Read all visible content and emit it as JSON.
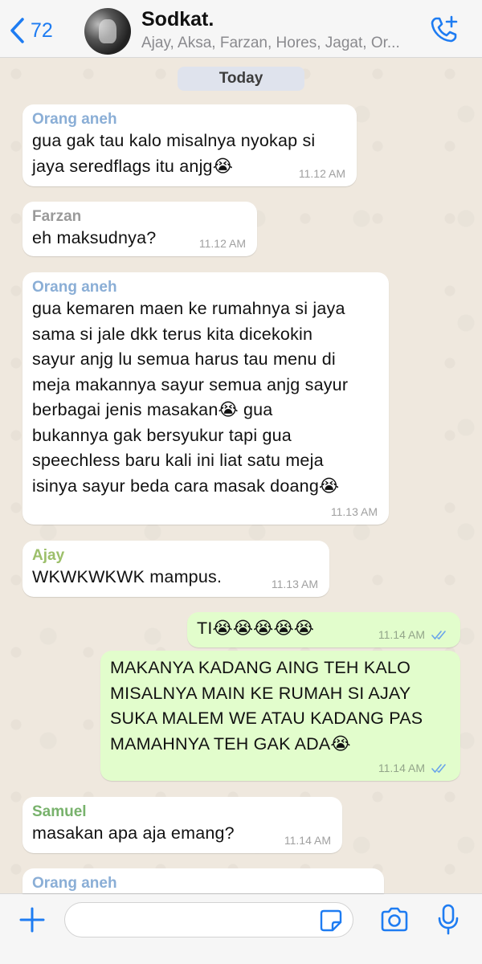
{
  "header": {
    "back_count": "72",
    "title": "Sodkat.",
    "members": "Ajay, Aksa, Farzan, Hores, Jagat, Or..."
  },
  "date_divider": "Today",
  "messages": [
    {
      "sender": "Orang aneh",
      "sender_color": "#8aaed6",
      "text": "gua gak tau kalo misalnya nyokap si\njaya seredflags itu anjg😭",
      "time": "11.12 AM",
      "outgoing": false
    },
    {
      "sender": "Farzan",
      "sender_color": "#9a9a9a",
      "text": "eh maksudnya?",
      "time": "11.12 AM",
      "outgoing": false
    },
    {
      "sender": "Orang aneh",
      "sender_color": "#8aaed6",
      "text": "gua kemaren maen ke rumahnya si jaya\nsama si jale dkk terus kita dicekokin\nsayur anjg lu semua harus tau menu di\nmeja makannya sayur semua anjg sayur\nberbagai jenis masakan😭 gua\nbukannya gak bersyukur tapi gua\nspeechless baru kali ini liat satu meja\nisinya sayur beda cara masak doang😭",
      "time": "11.13 AM",
      "outgoing": false
    },
    {
      "sender": "Ajay",
      "sender_color": "#9cbf6a",
      "text": "WKWKWKWK mampus.",
      "time": "11.13 AM",
      "outgoing": false
    },
    {
      "sender": "",
      "text": "TI😭😭😭😭😭",
      "time": "11.14 AM",
      "outgoing": true
    },
    {
      "sender": "",
      "text": "MAKANYA KADANG AING TEH KALO\nMISALNYA MAIN KE RUMAH SI AJAY\nSUKA MALEM WE ATAU KADANG PAS\nMAMAHNYA TEH GAK ADA😭",
      "time": "11.14 AM",
      "outgoing": true
    },
    {
      "sender": "Samuel",
      "sender_color": "#78b26c",
      "text": "masakan apa aja emang?",
      "time": "11.14 AM",
      "outgoing": false
    },
    {
      "sender": "Orang aneh",
      "sender_color": "#8aaed6",
      "text": "",
      "time": "",
      "outgoing": false
    }
  ],
  "composer": {
    "placeholder": ""
  },
  "colors": {
    "accent": "#1e7cf2",
    "outgoing_bubble": "#e2fdcc",
    "incoming_bubble": "#ffffff"
  },
  "icons": [
    "back-chevron-icon",
    "add-call-icon",
    "plus-icon",
    "sticker-icon",
    "camera-icon",
    "microphone-icon",
    "double-check-icon"
  ]
}
